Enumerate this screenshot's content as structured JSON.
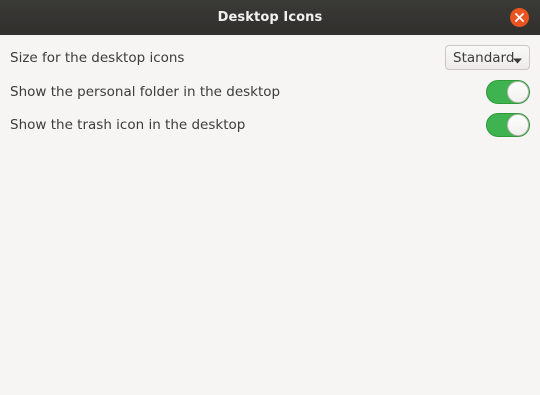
{
  "window": {
    "title": "Desktop Icons",
    "close_icon": "close-icon"
  },
  "settings": [
    {
      "label": "Size for the desktop icons",
      "control": "dropdown",
      "value": "Standard",
      "icon": "chevron-down-icon"
    },
    {
      "label": "Show the personal folder in the desktop",
      "control": "switch",
      "state": "on"
    },
    {
      "label": "Show the trash icon in the desktop",
      "control": "switch",
      "state": "on"
    }
  ],
  "colors": {
    "titlebar": "#302f2c",
    "close_button": "#e95420",
    "switch_on": "#3eb34f",
    "background": "#f6f5f4"
  }
}
